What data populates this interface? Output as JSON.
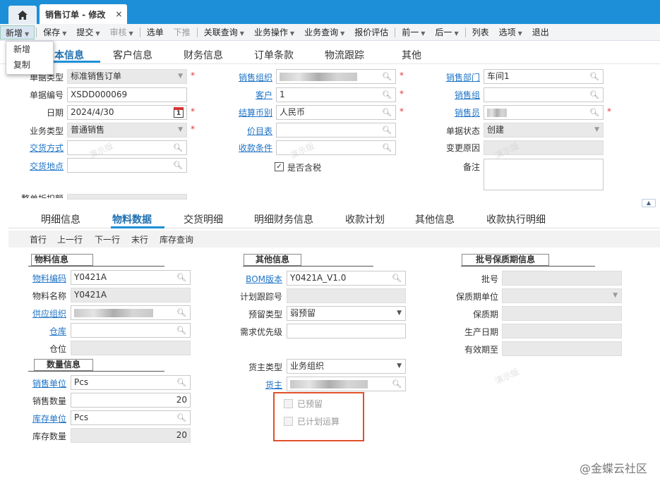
{
  "window": {
    "home_icon": "home-icon",
    "tab_title": "销售订单 - 修改",
    "tab_close": "×"
  },
  "toolbar": {
    "items": [
      {
        "label": "新增",
        "caret": true
      },
      {
        "label": "保存",
        "caret": true
      },
      {
        "label": "提交",
        "caret": true
      },
      {
        "label": "审核",
        "caret": true,
        "disabled": true
      },
      {
        "label": "选单"
      },
      {
        "label": "下推",
        "disabled": true
      },
      {
        "label": "关联查询",
        "caret": true
      },
      {
        "label": "业务操作",
        "caret": true
      },
      {
        "label": "业务查询",
        "caret": true
      },
      {
        "label": "报价评估"
      },
      {
        "label": "前一",
        "caret": true
      },
      {
        "label": "后一",
        "caret": true
      },
      {
        "label": "列表"
      },
      {
        "label": "选项",
        "caret": true
      },
      {
        "label": "退出"
      }
    ]
  },
  "dropdown": {
    "items": [
      "新增",
      "复制"
    ]
  },
  "tabs_top": {
    "t0": "基本信息",
    "t0_visible": "本信息",
    "t1": "客户信息",
    "t2": "财务信息",
    "t3": "订单条款",
    "t4": "物流跟踪",
    "t5": "其他"
  },
  "basic": {
    "doc_type_label": "单据类型",
    "doc_type": "标准销售订单",
    "doc_no_label": "单据编号",
    "doc_no": "XSDD000069",
    "date_label": "日期",
    "date": "2024/4/30",
    "cal_day": "1",
    "biz_type_label": "业务类型",
    "biz_type": "普通销售",
    "delivery_method_label": "交货方式",
    "delivery_place_label": "交货地点",
    "sales_org_label": "销售组织",
    "customer_label": "客户",
    "customer": "1",
    "currency_label": "结算币别",
    "currency": "人民币",
    "price_list_label": "价目表",
    "payment_terms_label": "收款条件",
    "tax_included_label": "是否含税",
    "tax_included_check": "✓",
    "sales_dept_label": "销售部门",
    "sales_dept": "车间1",
    "sales_group_label": "销售组",
    "salesman_label": "销售员",
    "status_label": "单据状态",
    "status": "创建",
    "change_reason_label": "变更原因",
    "remark_label": "备注",
    "partial_label": "整单折扣额"
  },
  "tabs_detail": {
    "t0": "明细信息",
    "t1": "物料数据",
    "t2": "交货明细",
    "t3": "明细财务信息",
    "t4": "收款计划",
    "t5": "其他信息",
    "t6": "收款执行明细"
  },
  "subbar": {
    "first": "首行",
    "prev": "上一行",
    "next": "下一行",
    "last": "末行",
    "stock": "库存查询"
  },
  "material": {
    "group": "物料信息",
    "code_label": "物料编码",
    "code": "Y0421A",
    "name_label": "物料名称",
    "name": "Y0421A",
    "supply_org_label": "供应组织",
    "warehouse_label": "仓库",
    "location_label": "仓位"
  },
  "qty": {
    "group": "数量信息",
    "sales_unit_label": "销售单位",
    "sales_unit": "Pcs",
    "sales_qty_label": "销售数量",
    "sales_qty": "20",
    "stock_unit_label": "库存单位",
    "stock_unit": "Pcs",
    "stock_qty_label": "库存数量",
    "stock_qty": "20"
  },
  "other": {
    "group": "其他信息",
    "bom_label": "BOM版本",
    "bom": "Y0421A_V1.0",
    "plan_track_label": "计划跟踪号",
    "reserve_type_label": "预留类型",
    "reserve_type": "弱预留",
    "demand_priority_label": "需求优先级",
    "owner_type_label": "货主类型",
    "owner_type": "业务组织",
    "owner_label": "货主",
    "reserved_label": "已预留",
    "planned_label": "已计划运算"
  },
  "lot": {
    "group": "批号保质期信息",
    "lot_label": "批号",
    "shelf_unit_label": "保质期单位",
    "shelf_life_label": "保质期",
    "prod_date_label": "生产日期",
    "expiry_label": "有效期至"
  },
  "watermark": "演示版",
  "brand": "@金蝶云社区"
}
